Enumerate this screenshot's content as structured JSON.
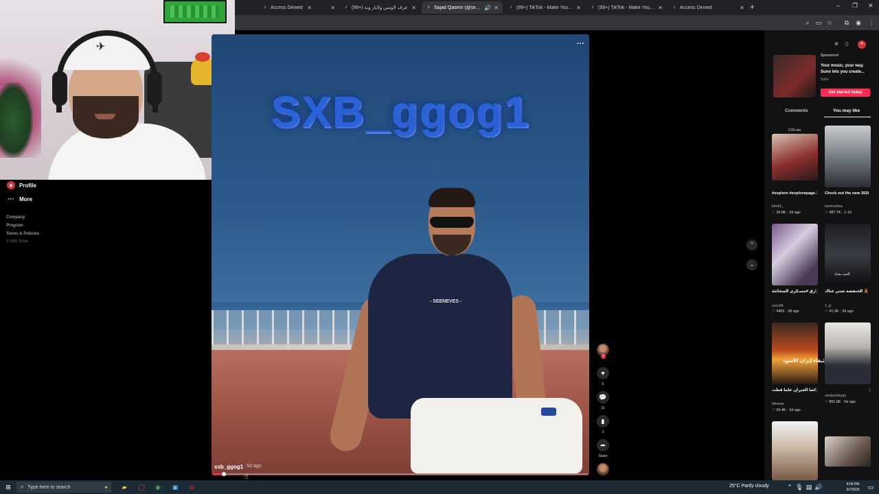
{
  "browser": {
    "tabs": [
      {
        "label": "",
        "icon": "tiktok-icon"
      },
      {
        "label": "Access Denied",
        "icon": "tiktok-icon"
      },
      {
        "label": "(99+) عرف لاونس ولايار ونه",
        "icon": "tiktok-icon"
      },
      {
        "label": "Sajad Qasem (@sxb_ggog",
        "icon": "tiktok-icon",
        "active": true
      },
      {
        "label": "(99+) TikTok - Make Your Day",
        "icon": "tiktok-icon"
      },
      {
        "label": "(99+) TikTok - Make Your Day",
        "icon": "tiktok-icon"
      },
      {
        "label": "Access Denied",
        "icon": "tiktok-icon"
      }
    ],
    "new_tab": "+",
    "window_controls": [
      "–",
      "❐",
      "✕"
    ]
  },
  "sidebar": {
    "profile_label": "Profile",
    "more_label": "More",
    "footer_links": [
      "Company",
      "Program",
      "Terms & Policies"
    ],
    "copyright": "© 2026 TikTok"
  },
  "video": {
    "overlay_text": "SXB_ggog1",
    "shirt_text": "- SEENEVES -",
    "author": "sxb_ggog1",
    "time_ago": "· 5d ago",
    "progress": 0.03,
    "more_icon": "···"
  },
  "actions": {
    "like_count": "6",
    "comment_count": "31",
    "save_count": "3",
    "share_label": "Share"
  },
  "right_panel": {
    "ad": {
      "sponsored": "Sponsored",
      "text": "Your music, your way. Suno lets you create...",
      "brand": "Suno",
      "cta": "Get started today"
    },
    "tabs": {
      "comments": "Comments",
      "you_may_like": "You may like"
    },
    "recommendations": [
      {
        "title": "#explore #explorepage...",
        "author": "khn91_",
        "likes": "26.8K",
        "age": "2d ago",
        "overlay": "2:00 am"
      },
      {
        "title": "Check out the new 2026 Loki h345...",
        "author": "beerrunbus",
        "likes": "487.7K",
        "age": "1-10",
        "overlay": ""
      },
      {
        "title": "مستطيع جيم ارق #مسـكرى الصحائثة...",
        "author": "zozo95",
        "likes": "4455",
        "age": "3d ago",
        "overlay": ""
      },
      {
        "title": "الحنفشة شتي عناك 🧸 #foryoupag...",
        "author": "2_js",
        "likes": "41.9K",
        "age": "3d ago",
        "overlay": "الحب بغداد"
      },
      {
        "title": "جيم اسود البحرية ايران يافراشا الجيران علما قطت",
        "author": "bilnews",
        "likes": "59.4K",
        "age": "2d ago",
        "overlay": "زئبقاء إيران الأسود"
      },
      {
        "title": "",
        "author": "vardanoleyan",
        "likes": "891.8K",
        "age": "5d ago",
        "overlay": ""
      },
      {
        "title": "",
        "author": "",
        "likes": "",
        "age": "",
        "overlay": ""
      },
      {
        "title": "",
        "author": "",
        "likes": "",
        "age": "",
        "overlay": ""
      }
    ]
  },
  "taskbar": {
    "search_placeholder": "Type here to search",
    "weather": "25°C  Partly cloudy",
    "time": "8:09 PM",
    "date": "3/7/2026"
  },
  "colors": {
    "tiktok_red": "#fe2c55",
    "overlay_blue": "#2a63d8"
  }
}
